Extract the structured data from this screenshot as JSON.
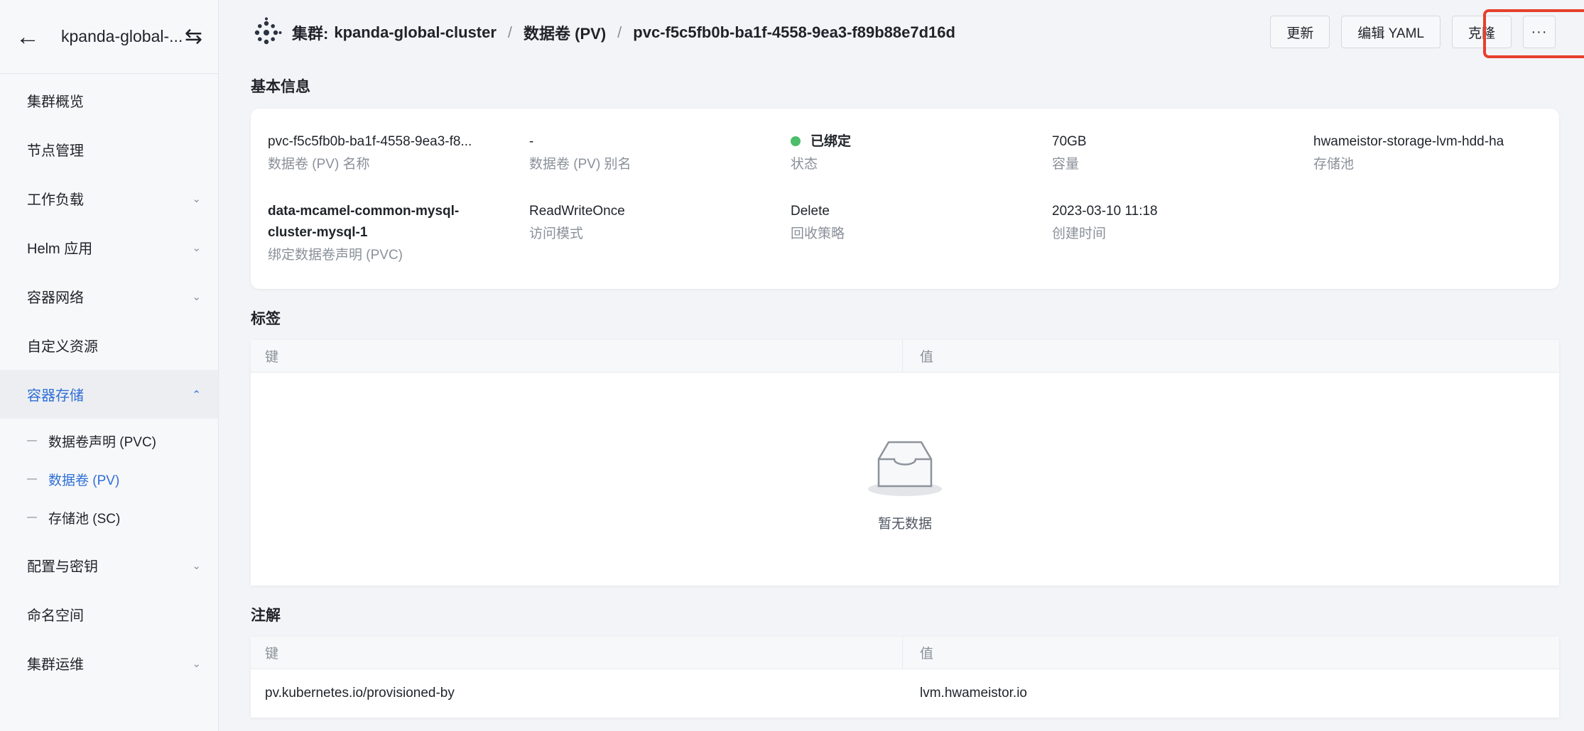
{
  "sidebar": {
    "cluster_name": "kpanda-global-...",
    "items": [
      {
        "label": "集群概览",
        "has_chevron": false
      },
      {
        "label": "节点管理",
        "has_chevron": false
      },
      {
        "label": "工作负载",
        "has_chevron": true
      },
      {
        "label": "Helm 应用",
        "has_chevron": true
      },
      {
        "label": "容器网络",
        "has_chevron": true
      },
      {
        "label": "自定义资源",
        "has_chevron": false
      },
      {
        "label": "容器存储",
        "has_chevron": true,
        "expanded": true,
        "active": true
      },
      {
        "label": "配置与密钥",
        "has_chevron": true
      },
      {
        "label": "命名空间",
        "has_chevron": false
      },
      {
        "label": "集群运维",
        "has_chevron": true
      }
    ],
    "storage_subitems": [
      {
        "label": "数据卷声明 (PVC)"
      },
      {
        "label": "数据卷 (PV)",
        "active": true
      },
      {
        "label": "存储池 (SC)"
      }
    ]
  },
  "breadcrumb": {
    "prefix": "集群:",
    "cluster": "kpanda-global-cluster",
    "separator": "/",
    "section": "数据卷 (PV)",
    "current": "pvc-f5c5fb0b-ba1f-4558-9ea3-f89b88e7d16d"
  },
  "actions": {
    "update": "更新",
    "edit_yaml": "编辑 YAML",
    "clone": "克隆",
    "more": "···"
  },
  "basic_info": {
    "title": "基本信息",
    "pv_name": {
      "value": "pvc-f5c5fb0b-ba1f-4558-9ea3-f8...",
      "label": "数据卷 (PV) 名称"
    },
    "pv_alias": {
      "value": "-",
      "label": "数据卷 (PV) 别名"
    },
    "status": {
      "value": "已绑定",
      "label": "状态"
    },
    "capacity": {
      "value": "70GB",
      "label": "容量"
    },
    "storage_pool": {
      "value": "hwameistor-storage-lvm-hdd-ha",
      "label": "存储池"
    },
    "bound_pvc": {
      "value_line1": "data-mcamel-common-mysql-",
      "value_line2": "cluster-mysql-1",
      "label": "绑定数据卷声明 (PVC)"
    },
    "access_mode": {
      "value": "ReadWriteOnce",
      "label": "访问模式"
    },
    "reclaim_policy": {
      "value": "Delete",
      "label": "回收策略"
    },
    "created": {
      "value": "2023-03-10 11:18",
      "label": "创建时间"
    }
  },
  "labels": {
    "title": "标签",
    "col_key": "键",
    "col_value": "值",
    "empty_text": "暂无数据"
  },
  "annotations": {
    "title": "注解",
    "col_key": "键",
    "col_value": "值",
    "rows": [
      {
        "key": "pv.kubernetes.io/provisioned-by",
        "value": "lvm.hwameistor.io"
      }
    ]
  },
  "colors": {
    "accent": "#2f6fd6",
    "status_bound": "#4cbd6b",
    "highlight_box": "#e63f2d"
  }
}
